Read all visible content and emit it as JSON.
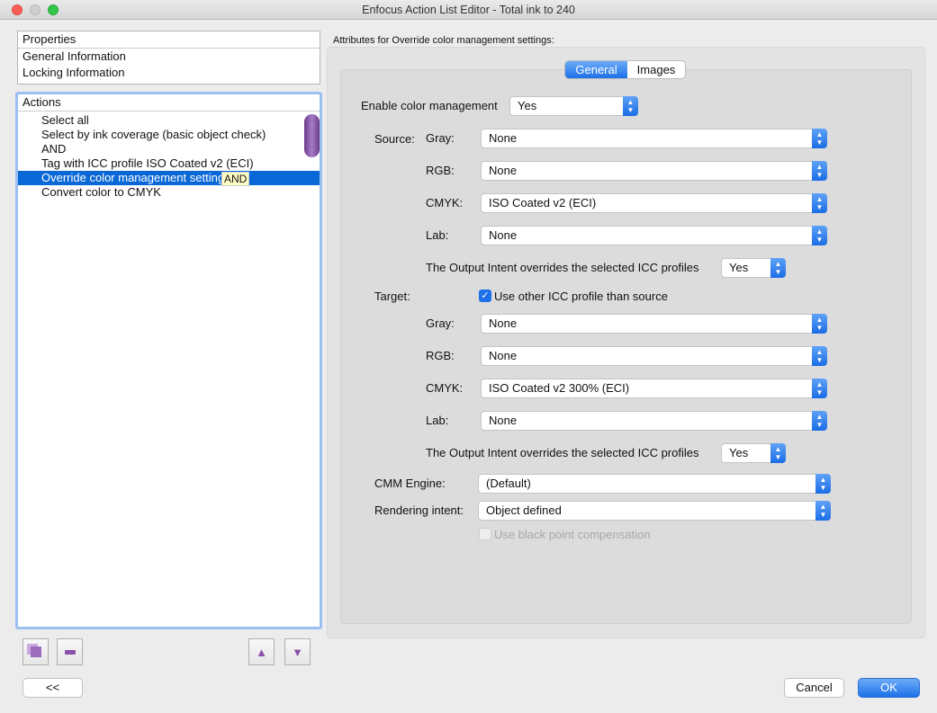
{
  "window": {
    "title": "Enfocus Action List Editor - Total ink to 240"
  },
  "properties": {
    "header": "Properties",
    "items": [
      "General Information",
      "Locking Information"
    ]
  },
  "actions": {
    "header": "Actions",
    "items": [
      "Select all",
      "Select by ink coverage (basic object check)",
      "AND",
      "Tag with ICC profile ISO Coated v2 (ECI)",
      "Override color management settings",
      "Convert color to CMYK"
    ],
    "selected_index": 4,
    "tooltip": "AND"
  },
  "buttons": {
    "collapse": "<<",
    "cancel": "Cancel",
    "ok": "OK"
  },
  "attributes": {
    "title": "Attributes for Override color management settings:",
    "tabs": [
      "General",
      "Images"
    ],
    "enable_label": "Enable color management",
    "enable_value": "Yes",
    "source_label": "Source:",
    "target_label": "Target:",
    "source": [
      {
        "label": "Gray:",
        "value": "None"
      },
      {
        "label": "RGB:",
        "value": "None"
      },
      {
        "label": "CMYK:",
        "value": "ISO Coated v2 (ECI)"
      },
      {
        "label": "Lab:",
        "value": "None"
      }
    ],
    "source_oi_label": "The Output Intent overrides the selected ICC profiles",
    "source_oi_value": "Yes",
    "use_other_label": "Use other ICC profile than source",
    "use_other_checked": true,
    "target": [
      {
        "label": "Gray:",
        "value": "None"
      },
      {
        "label": "RGB:",
        "value": "None"
      },
      {
        "label": "CMYK:",
        "value": "ISO Coated v2 300% (ECI)"
      },
      {
        "label": "Lab:",
        "value": "None"
      }
    ],
    "target_oi_label": "The Output Intent overrides the selected ICC profiles",
    "target_oi_value": "Yes",
    "cmm_label": "CMM Engine:",
    "cmm_value": "(Default)",
    "intent_label": "Rendering intent:",
    "intent_value": "Object defined",
    "bpc_label": "Use black point compensation",
    "bpc_checked": false
  },
  "colors": {
    "accent": "#0a68d6",
    "purple": "#8a4fa8"
  }
}
